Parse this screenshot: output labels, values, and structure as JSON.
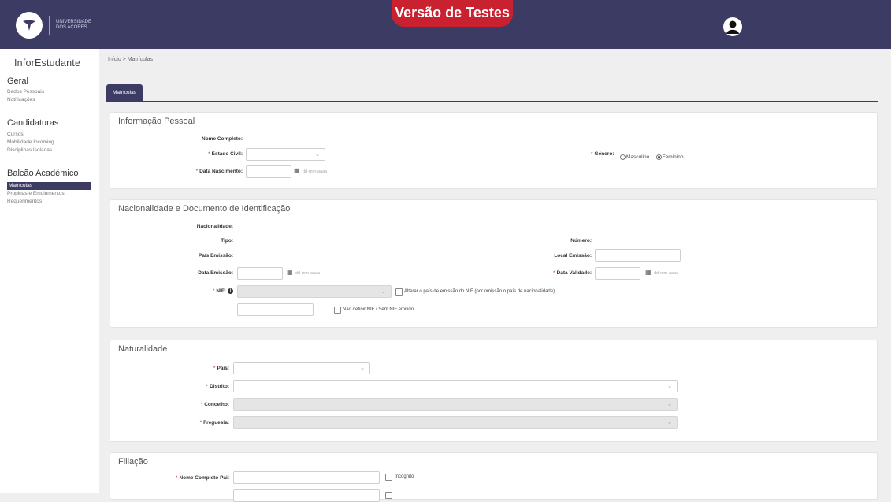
{
  "header": {
    "logo_text_line1": "Universidade",
    "logo_text_line2": "dos Açores",
    "banner": "Versão de Testes"
  },
  "sidebar": {
    "app_title": "InforEstudante",
    "sections": [
      {
        "title": "Geral",
        "items": [
          "Dados Pessoais",
          "Notificações"
        ]
      },
      {
        "title": "Candidaturas",
        "items": [
          "Cursos",
          "Mobilidade Incoming",
          "Disciplinas Isoladas"
        ]
      },
      {
        "title": "Balcão Académico",
        "items": [
          "Matrículas",
          "Propinas e Emolumentos",
          "Requerimentos"
        ]
      }
    ],
    "active_item": "Matrículas"
  },
  "breadcrumb": "Início > Matrículas",
  "tab": "Matrículas",
  "pessoal": {
    "title": "Informação Pessoal",
    "nome_label": "Nome Completo:",
    "estado_civil_label": "Estado Civil:",
    "data_nasc_label": "Data Nascimento:",
    "date_placeholder": "dd-mm-aaaa",
    "genero_label": "Género:",
    "genero_options": [
      "Masculino",
      "Feminino"
    ],
    "genero_selected": "Feminino"
  },
  "nacionalidade": {
    "title": "Nacionalidade e Documento de Identificação",
    "nacionalidade_label": "Nacionalidade:",
    "tipo_label": "Tipo:",
    "numero_label": "Número:",
    "pais_emissao_label": "País Emissão:",
    "local_emissao_label": "Local Emissão:",
    "data_emissao_label": "Data Emissão:",
    "data_validade_label": "Data Validade:",
    "date_placeholder": "dd-mm-aaaa",
    "nif_label": "NIF:",
    "alterar_pais_label": "Alterar o país de emissão do NIF (por omissão o país de nacionalidade)",
    "nao_definir_nif_label": "Não definir NIF / Sem NIF emitido"
  },
  "naturalidade": {
    "title": "Naturalidade",
    "pais_label": "País:",
    "distrito_label": "Distrito:",
    "concelho_label": "Concelho:",
    "freguesia_label": "Freguesia:"
  },
  "filiacao": {
    "title": "Filiação",
    "nome_pai_label": "Nome Completo Pai:",
    "incognito_label": "Incógnito"
  },
  "colors": {
    "navy": "#3b3b63",
    "banner_red": "#c9212f"
  }
}
